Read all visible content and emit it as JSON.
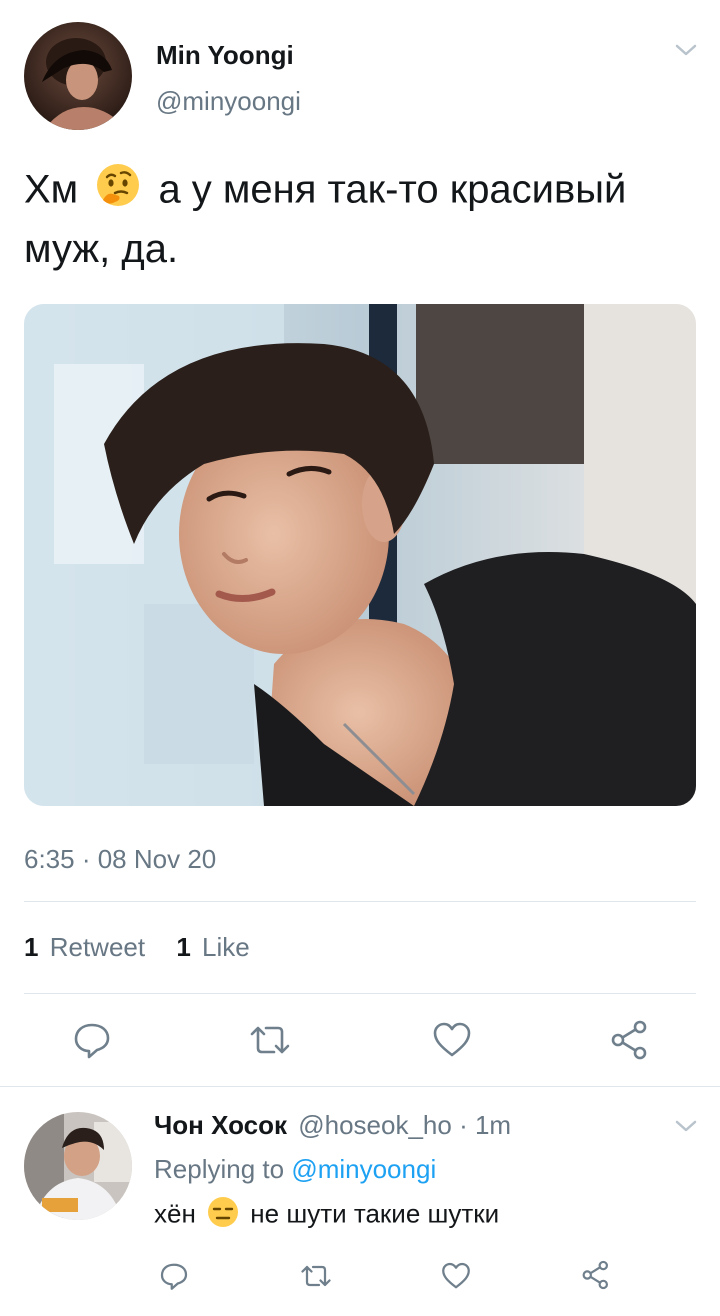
{
  "main_tweet": {
    "display_name": "Min Yoongi",
    "handle": "@minyoongi",
    "text_before_emoji": "Хм",
    "emoji": "thinking-face",
    "text_after_emoji": "а у меня так-то красивый муж, да.",
    "timestamp": "6:35 · 08 Nov 20",
    "retweet_count": "1",
    "retweet_label": "Retweet",
    "like_count": "1",
    "like_label": "Like"
  },
  "reply_tweet": {
    "display_name": "Чон Хосок",
    "handle": "@hoseok_ho",
    "time": "· 1m",
    "replying_prefix": "Replying to",
    "replying_to": "@minyoongi",
    "text_before_emoji": "хён",
    "emoji": "expressionless-face",
    "text_after_emoji": "не шути такие шутки"
  },
  "actions": [
    "reply-icon",
    "retweet-icon",
    "like-icon",
    "share-icon"
  ],
  "colors": {
    "accent": "#1da1f2",
    "muted": "#687784",
    "icon": "#6f7f8c",
    "divider": "#e1e6ea"
  }
}
